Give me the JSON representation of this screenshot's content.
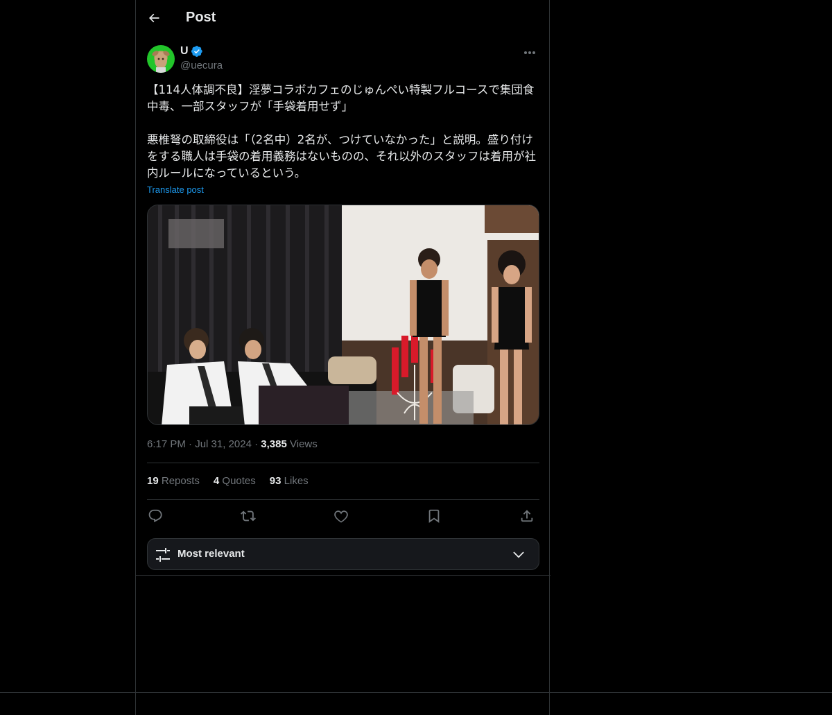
{
  "header": {
    "title": "Post",
    "back_icon": "arrow-left-icon"
  },
  "author": {
    "display_name": "U",
    "handle": "@uecura",
    "verified": true,
    "verified_color": "#1d9bf0"
  },
  "post": {
    "text": "【114人体調不良】淫夢コラボカフェのじゅんぺい特製フルコースで集団食中毒、一部スタッフが「手袋着用せず」\n\n悪椎弩の取締役は「（2名中）2名が、つけていなかった」と説明。盛り付けをする職人は手袋の着用義務はないものの、それ以外のスタッフは着用が社内ルールになっているという。",
    "translate_label": "Translate post",
    "time": "6:17 PM",
    "date": "Jul 31, 2024",
    "views_count": "3,385",
    "views_label": "Views"
  },
  "stats": {
    "reposts_count": "19",
    "reposts_label": "Reposts",
    "quotes_count": "4",
    "quotes_label": "Quotes",
    "likes_count": "93",
    "likes_label": "Likes"
  },
  "actions": [
    "reply-icon",
    "repost-icon",
    "like-icon",
    "bookmark-icon",
    "share-icon"
  ],
  "sort": {
    "label": "Most relevant",
    "icon": "sliders-icon",
    "chevron": "chevron-down-icon"
  },
  "colors": {
    "accent": "#1d9bf0",
    "text": "#e7e9ea",
    "muted": "#71767b",
    "border": "#2f3336"
  }
}
